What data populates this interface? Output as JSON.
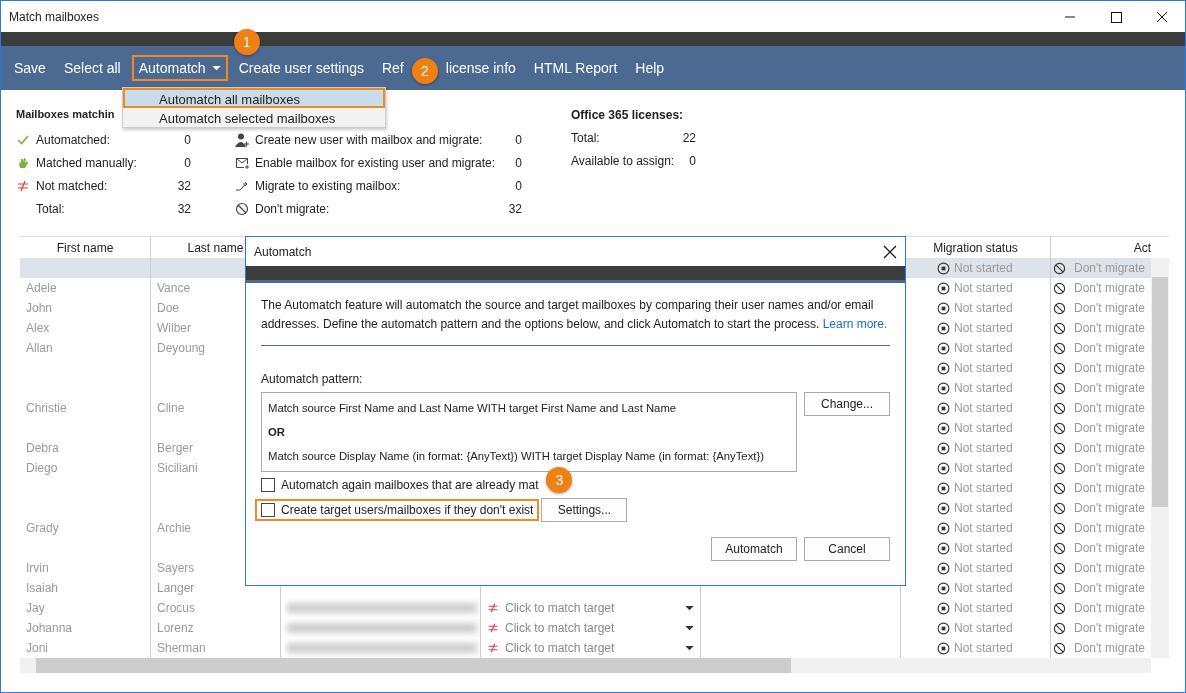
{
  "window": {
    "title": "Match mailboxes"
  },
  "menu": [
    {
      "label": "Save",
      "framed": false
    },
    {
      "label": "Select all",
      "framed": false
    },
    {
      "label": "Automatch",
      "kind": "dropdown",
      "framed": true,
      "callout": "1"
    },
    {
      "label": "Create user settings",
      "framed": false
    },
    {
      "label_parts": [
        "Ref",
        "license info"
      ],
      "framed": false,
      "callout": "2"
    },
    {
      "label": "HTML Report",
      "framed": false
    },
    {
      "label": "Help",
      "framed": false
    }
  ],
  "dropdown": [
    {
      "label": "Automatch all mailboxes",
      "selected": true,
      "framed": true
    },
    {
      "label": "Automatch selected mailboxes",
      "selected": false,
      "framed": false
    }
  ],
  "summary": {
    "matching": {
      "title": "Mailboxes matchin",
      "rows": [
        {
          "kind": "automatched",
          "label": "Automatched:",
          "value": "0"
        },
        {
          "kind": "manual",
          "label": "Matched manually:",
          "value": "0"
        },
        {
          "kind": "not-matched",
          "label": "Not matched:",
          "value": "32"
        },
        {
          "kind": "total",
          "label": "Total:",
          "value": "32"
        }
      ]
    },
    "actions": {
      "rows": [
        {
          "kind": "new-user",
          "label": "Create new user with mailbox and migrate:",
          "value": "0"
        },
        {
          "kind": "enable-mailbox",
          "label": "Enable mailbox for existing user and migrate:",
          "value": "0"
        },
        {
          "kind": "migrate",
          "label": "Migrate to existing mailbox:",
          "value": "0"
        },
        {
          "kind": "dont",
          "label": "Don't migrate:",
          "value": "32"
        }
      ]
    },
    "licenses": {
      "title": "Office 365 licenses:",
      "rows": [
        {
          "label": "Total:",
          "value": "22"
        },
        {
          "label": "Available to assign:",
          "value": "0"
        }
      ]
    }
  },
  "table": {
    "columns": [
      {
        "kind": "first",
        "label": "First name"
      },
      {
        "kind": "last",
        "label": "Last name"
      },
      {
        "kind": "status",
        "label": "Migration status"
      },
      {
        "kind": "action",
        "label": "Act"
      }
    ],
    "rows": [
      {
        "selected": true,
        "status": "Not started",
        "action": "Don't migrate"
      },
      {
        "selected": false,
        "first": "Adele",
        "last": "Vance",
        "status": "Not started",
        "action": "Don't migrate"
      },
      {
        "selected": false,
        "first": "John",
        "last": "Doe",
        "status": "Not started",
        "action": "Don't migrate"
      },
      {
        "selected": false,
        "first": "Alex",
        "last": "Wilber",
        "status": "Not started",
        "action": "Don't migrate"
      },
      {
        "selected": false,
        "first": "Allan",
        "last": "Deyoung",
        "status": "Not started",
        "action": "Don't migrate"
      },
      {
        "selected": false,
        "status": "Not started",
        "action": "Don't migrate"
      },
      {
        "selected": false,
        "status": "Not started",
        "action": "Don't migrate"
      },
      {
        "selected": false,
        "first": "Christie",
        "last": "Cline",
        "status": "Not started",
        "action": "Don't migrate"
      },
      {
        "selected": false,
        "status": "Not started",
        "action": "Don't migrate"
      },
      {
        "selected": false,
        "first": "Debra",
        "last": "Berger",
        "status": "Not started",
        "action": "Don't migrate"
      },
      {
        "selected": false,
        "first": "Diego",
        "last": "Siciliani",
        "status": "Not started",
        "action": "Don't migrate"
      },
      {
        "selected": false,
        "status": "Not started",
        "action": "Don't migrate"
      },
      {
        "selected": false,
        "status": "Not started",
        "action": "Don't migrate"
      },
      {
        "selected": false,
        "first": "Grady",
        "last": "Archie",
        "status": "Not started",
        "action": "Don't migrate"
      },
      {
        "selected": false,
        "status": "Not started",
        "action": "Don't migrate"
      },
      {
        "selected": false,
        "first": "Irvin",
        "last": "Sayers",
        "status": "Not started",
        "action": "Don't migrate"
      },
      {
        "selected": false,
        "first": "Isaiah",
        "last": "Langer",
        "status": "Not started",
        "action": "Don't migrate"
      },
      {
        "selected": false,
        "first": "Jay",
        "last": "Crocus",
        "email_redacted": true,
        "target": "Click to match target",
        "status": "Not started",
        "action": "Don't migrate"
      },
      {
        "selected": false,
        "first": "Johanna",
        "last": "Lorenz",
        "email_redacted": true,
        "target": "Click to match target",
        "status": "Not started",
        "action": "Don't migrate"
      },
      {
        "selected": false,
        "first": "Joni",
        "last": "Sherman",
        "email_redacted": true,
        "target": "Click to match target",
        "status": "Not started",
        "action": "Don't migrate"
      }
    ]
  },
  "dialog": {
    "title": "Automatch",
    "description": "The Automatch feature will automatch the source and target mailboxes by comparing their user names and/or email addresses. Define the automatch pattern and the options below, and click Automatch to start the process.",
    "link": "Learn more.",
    "pattern_label": "Automatch pattern:",
    "pattern": [
      {
        "kind": "rule",
        "text": "Match source First Name and Last Name WITH target First Name and Last Name"
      },
      {
        "kind": "operator",
        "text": "OR"
      },
      {
        "kind": "rule",
        "text": "Match source Display Name (in format: {AnyText}) WITH target Display Name (in format: {AnyText})"
      }
    ],
    "change_button": "Change...",
    "options": [
      {
        "label": "Automatch again mailboxes that are already mat",
        "checked": false,
        "framed": false,
        "callout": "3"
      },
      {
        "label": "Create target users/mailboxes if they don't exist",
        "checked": false,
        "framed": true,
        "button": "Settings..."
      }
    ],
    "buttons": [
      "Automatch",
      "Cancel"
    ]
  }
}
